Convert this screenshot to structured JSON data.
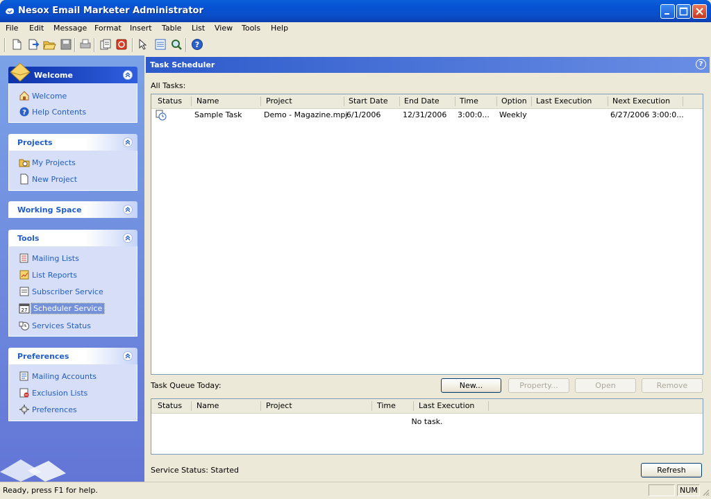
{
  "window": {
    "title": "Nesox Email Marketer Administrator"
  },
  "menu": [
    "File",
    "Edit",
    "Message",
    "Format",
    "Insert",
    "Table",
    "List",
    "View",
    "Tools",
    "Help"
  ],
  "toolbar_icons": [
    "new-document-icon",
    "import-icon",
    "open-folder-icon",
    "save-icon",
    "print-icon",
    "preview-icon",
    "stop-icon",
    "select-icon",
    "list-icon",
    "search-icon",
    "help-icon"
  ],
  "sidebar": {
    "welcome": {
      "title": "Welcome",
      "items": [
        "Welcome",
        "Help Contents"
      ]
    },
    "projects": {
      "title": "Projects",
      "items": [
        "My Projects",
        "New Project"
      ]
    },
    "working_space": {
      "title": "Working Space"
    },
    "tools": {
      "title": "Tools",
      "items": [
        "Mailing Lists",
        "List Reports",
        "Subscriber Service",
        "Scheduler Service",
        "Services Status"
      ],
      "selected": "Scheduler Service"
    },
    "preferences": {
      "title": "Preferences",
      "items": [
        "Mailing Accounts",
        "Exclusion Lists",
        "Preferences"
      ]
    }
  },
  "main": {
    "title": "Task Scheduler",
    "all_tasks_label": "All Tasks:",
    "tasks_columns": [
      "Status",
      "Name",
      "Project",
      "Start Date",
      "End Date",
      "Time",
      "Option",
      "Last Execution",
      "Next Execution"
    ],
    "tasks": [
      {
        "status_icon": "scheduled-task-icon",
        "name": "Sample Task",
        "project": "Demo - Magazine.mpj",
        "start": "6/1/2006",
        "end": "12/31/2006",
        "time": "3:00:0...",
        "option": "Weekly",
        "last": "",
        "next": "6/27/2006 3:00:0..."
      }
    ],
    "queue_label": "Task Queue Today:",
    "buttons": {
      "new": "New...",
      "property": "Property...",
      "open": "Open",
      "remove": "Remove",
      "refresh": "Refresh"
    },
    "queue_columns": [
      "Status",
      "Name",
      "Project",
      "Time",
      "Last Execution"
    ],
    "queue_empty": "No task.",
    "service_status": "Service Status: Started"
  },
  "statusbar": {
    "text": "Ready, press F1 for help.",
    "num": "NUM"
  }
}
